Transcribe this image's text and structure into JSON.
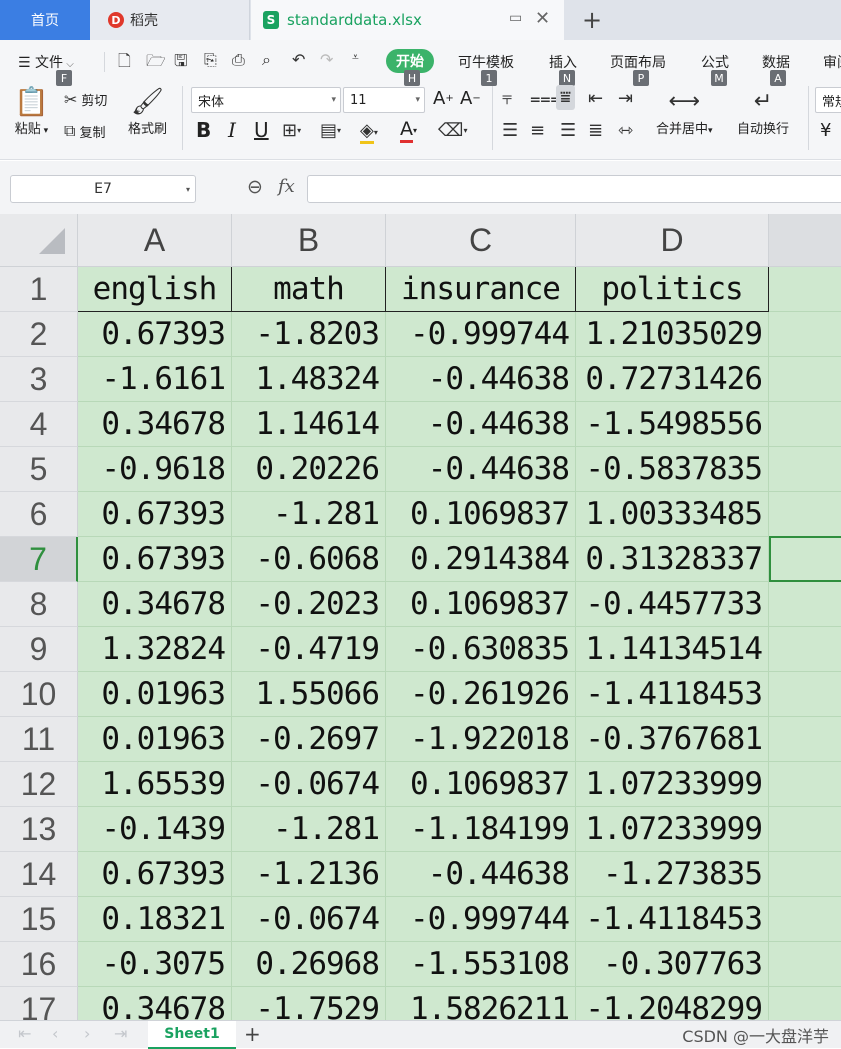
{
  "tabs": {
    "home": "首页",
    "daoke": "稻壳",
    "document": "standarddata.xlsx"
  },
  "menu": {
    "file": "文件",
    "start": "开始",
    "template": "可牛模板",
    "insert": "插入",
    "page_layout": "页面布局",
    "formula": "公式",
    "data": "数据",
    "review": "审阅"
  },
  "keytips": {
    "file": "F",
    "start": "H",
    "template": "1",
    "insert": "N",
    "page_layout": "P",
    "formula": "M",
    "data": "A"
  },
  "toolbar": {
    "paste": "粘贴",
    "cut": "剪切",
    "copy": "复制",
    "format_painter": "格式刷",
    "font_name": "宋体",
    "font_size": "11",
    "merge_center": "合并居中",
    "wrap_text": "自动换行",
    "number_format": "常规"
  },
  "formula_bar": {
    "cell_ref": "E7",
    "fx": "fx",
    "content": ""
  },
  "sheet": {
    "columns": [
      "A",
      "B",
      "C",
      "D"
    ],
    "headers": [
      "english",
      "math",
      "insurance",
      "politics"
    ],
    "rows": [
      [
        "0.67393",
        "-1.8203",
        "-0.999744",
        "1.21035029"
      ],
      [
        "-1.6161",
        "1.48324",
        "-0.44638",
        "0.72731426"
      ],
      [
        "0.34678",
        "1.14614",
        "-0.44638",
        "-1.5498556"
      ],
      [
        "-0.9618",
        "0.20226",
        "-0.44638",
        "-0.5837835"
      ],
      [
        "0.67393",
        "-1.281",
        "0.1069837",
        "1.00333485"
      ],
      [
        "0.67393",
        "-0.6068",
        "0.2914384",
        "0.31328337"
      ],
      [
        "0.34678",
        "-0.2023",
        "0.1069837",
        "-0.4457733"
      ],
      [
        "1.32824",
        "-0.4719",
        "-0.630835",
        "1.14134514"
      ],
      [
        "0.01963",
        "1.55066",
        "-0.261926",
        "-1.4118453"
      ],
      [
        "0.01963",
        "-0.2697",
        "-1.922018",
        "-0.3767681"
      ],
      [
        "1.65539",
        "-0.0674",
        "0.1069837",
        "1.07233999"
      ],
      [
        "-0.1439",
        "-1.281",
        "-1.184199",
        "1.07233999"
      ],
      [
        "0.67393",
        "-1.2136",
        "-0.44638",
        "-1.273835"
      ],
      [
        "0.18321",
        "-0.0674",
        "-0.999744",
        "-1.4118453"
      ],
      [
        "-0.3075",
        "0.26968",
        "-1.553108",
        "-0.307763"
      ],
      [
        "0.34678",
        "-1.7529",
        "1.5826211",
        "-1.2048299"
      ]
    ]
  },
  "sheet_tabs": {
    "active": "Sheet1",
    "add": "+"
  },
  "watermark": "CSDN @一大盘洋芋",
  "colors": {
    "grid_bg": "#cfe8cf",
    "accent": "#1aa260",
    "home_tab": "#3b7ee3",
    "selection": "#2f8f3e"
  }
}
